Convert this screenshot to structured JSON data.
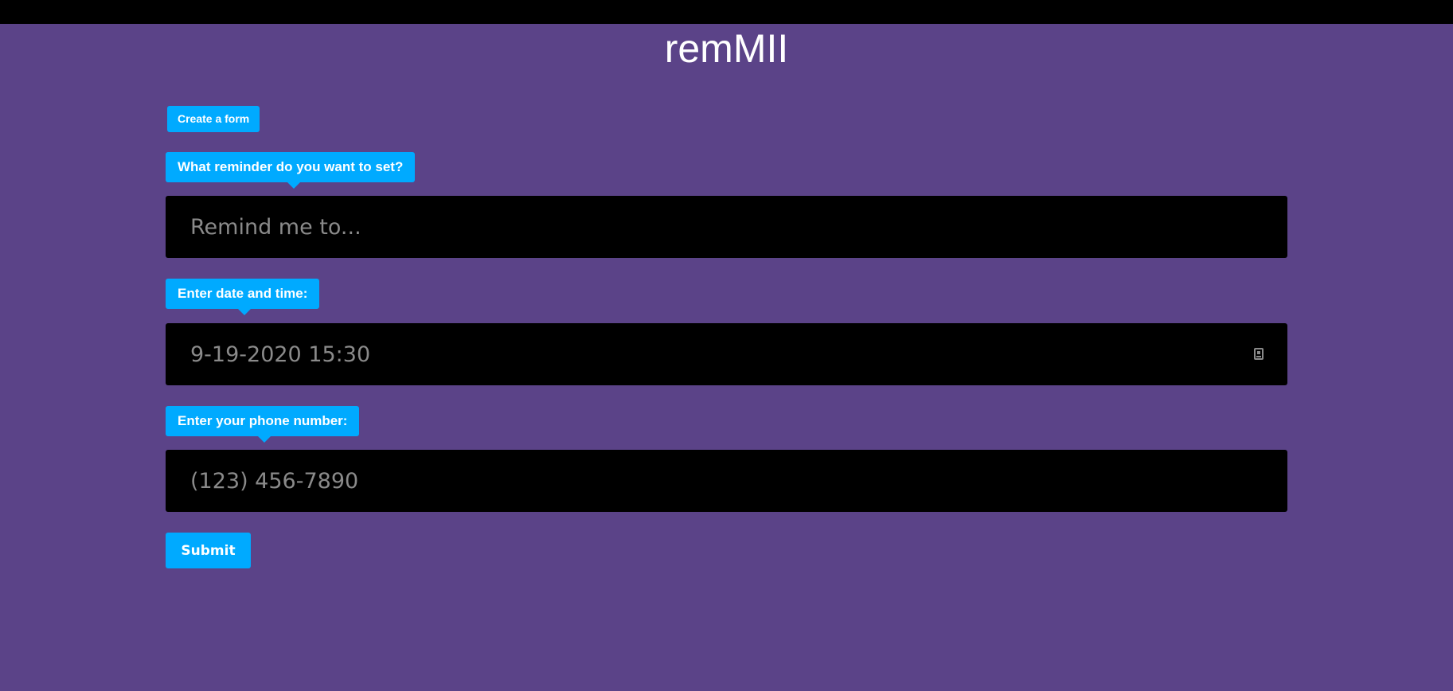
{
  "app": {
    "title": "remMII"
  },
  "form": {
    "create_label": "Create a form",
    "reminder": {
      "label": "What reminder do you want to set?",
      "value": "",
      "placeholder": "Remind me to..."
    },
    "datetime": {
      "label": "Enter date and time:",
      "value": "",
      "placeholder": "9-19-2020 15:30",
      "icon": "calendar-icon"
    },
    "phone": {
      "label": "Enter your phone number:",
      "value": "",
      "placeholder": "(123) 456-7890"
    },
    "submit_label": "Submit"
  },
  "colors": {
    "background": "#5b4388",
    "topbar": "#000000",
    "accent": "#00aaff",
    "input_bg": "#000000",
    "placeholder": "#8a8a8a"
  }
}
